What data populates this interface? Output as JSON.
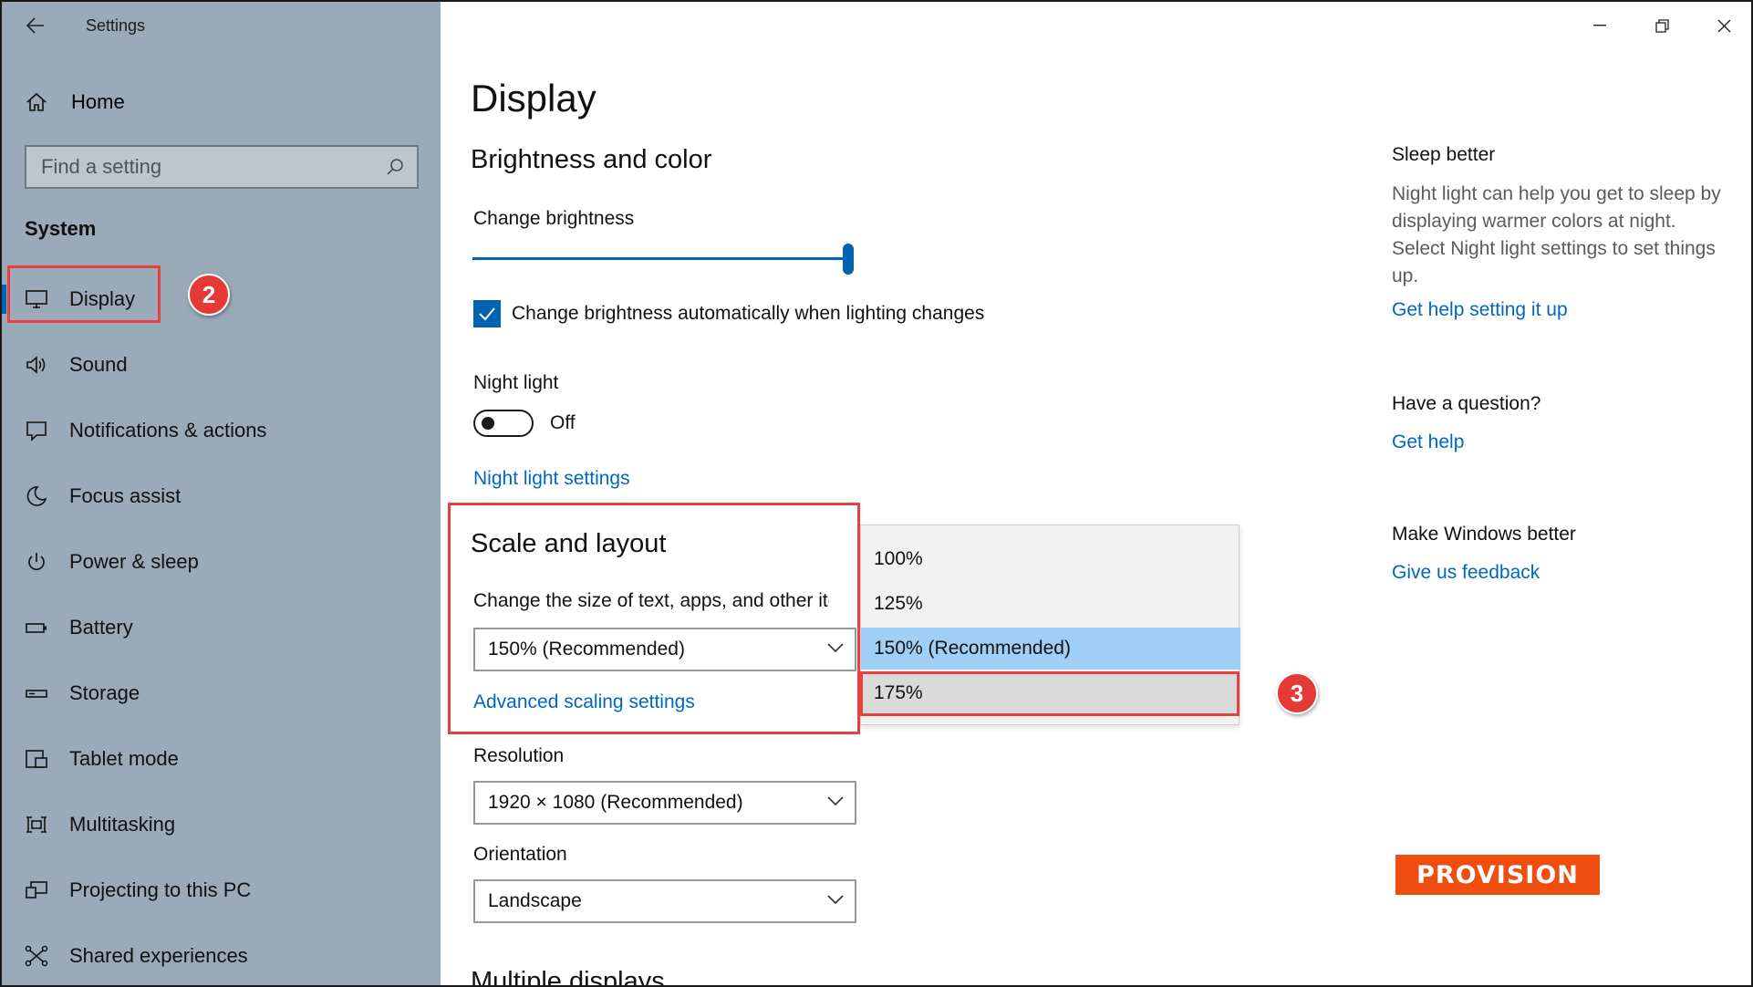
{
  "window": {
    "title": "Settings"
  },
  "sidebar": {
    "home_label": "Home",
    "search_placeholder": "Find a setting",
    "group_label": "System",
    "items": [
      {
        "label": "Display",
        "icon": "monitor-icon"
      },
      {
        "label": "Sound",
        "icon": "speaker-icon"
      },
      {
        "label": "Notifications & actions",
        "icon": "notification-icon"
      },
      {
        "label": "Focus assist",
        "icon": "moon-icon"
      },
      {
        "label": "Power & sleep",
        "icon": "power-icon"
      },
      {
        "label": "Battery",
        "icon": "battery-icon"
      },
      {
        "label": "Storage",
        "icon": "storage-icon"
      },
      {
        "label": "Tablet mode",
        "icon": "tablet-icon"
      },
      {
        "label": "Multitasking",
        "icon": "multitasking-icon"
      },
      {
        "label": "Projecting to this PC",
        "icon": "projecting-icon"
      },
      {
        "label": "Shared experiences",
        "icon": "shared-icon"
      }
    ]
  },
  "main": {
    "page_title": "Display",
    "brightness": {
      "heading": "Brightness and color",
      "change_label": "Change brightness",
      "auto_label": "Change brightness automatically when lighting changes",
      "level_percent": 100,
      "auto_checked": true
    },
    "night_light": {
      "label": "Night light",
      "state": "Off",
      "settings_link": "Night light settings"
    },
    "scale": {
      "heading": "Scale and layout",
      "change_label": "Change the size of text, apps, and other items",
      "selected": "150% (Recommended)",
      "advanced_link": "Advanced scaling settings",
      "options": [
        "100%",
        "125%",
        "150% (Recommended)",
        "175%"
      ]
    },
    "resolution": {
      "label": "Resolution",
      "value": "1920 × 1080 (Recommended)"
    },
    "orientation": {
      "label": "Orientation",
      "value": "Landscape"
    },
    "multiple_displays_heading": "Multiple displays"
  },
  "right_column": {
    "sleep_title": "Sleep better",
    "sleep_body": "Night light can help you get to sleep by displaying warmer colors at night. Select Night light settings to set things up.",
    "sleep_link": "Get help setting it up",
    "question_title": "Have a question?",
    "question_link": "Get help",
    "feedback_title": "Make Windows better",
    "feedback_link": "Give us feedback"
  },
  "annotations": {
    "badge_display": "2",
    "badge_option": "3"
  },
  "logo_text": "PROVISION",
  "colors": {
    "accent": "#0063b1",
    "link": "#0067c0",
    "sidebar_bg": "#9aaab9",
    "annotation": "#e64040",
    "dropdown_selected": "#9fcff7",
    "logo_bg": "#f04e10"
  }
}
